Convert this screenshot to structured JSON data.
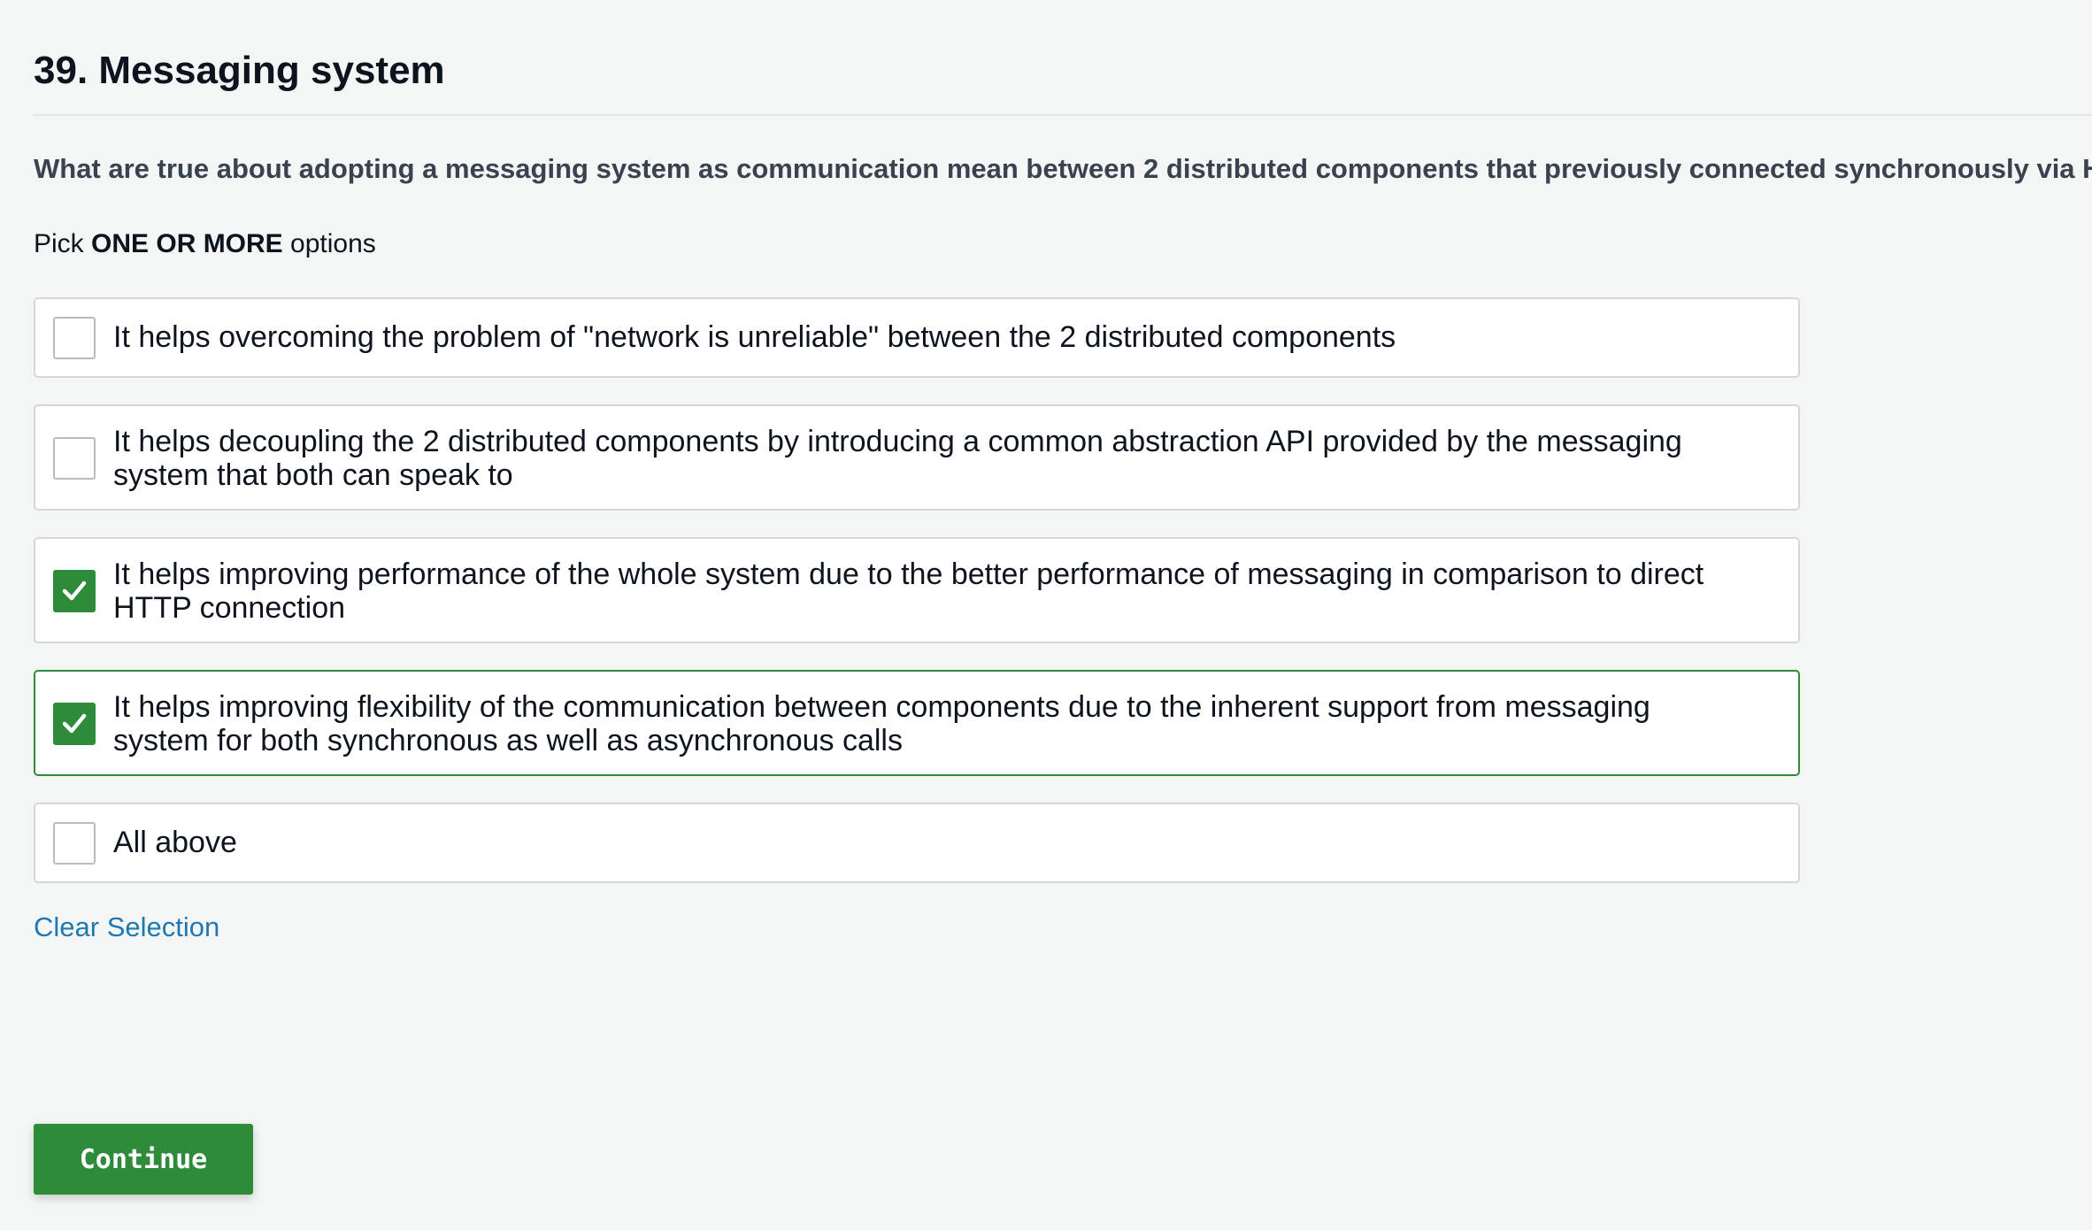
{
  "question": {
    "title": "39. Messaging system",
    "text": "What are true about adopting a messaging system as communication mean between 2 distributed components that previously connected synchronously via HTTP?",
    "instruction_prefix": "Pick ",
    "instruction_emphasis": "ONE OR MORE",
    "instruction_suffix": " options"
  },
  "options": [
    {
      "label": "It helps overcoming the problem of \"network is unreliable\" between the 2 distributed components",
      "checked": false
    },
    {
      "label": "It helps decoupling the 2 distributed components by introducing a common abstraction API provided by the messaging system that both can speak to",
      "checked": false
    },
    {
      "label": "It helps improving performance of the whole system due to the better performance of messaging in comparison to direct HTTP connection",
      "checked": true
    },
    {
      "label": "It helps improving flexibility of the communication between components due to the inherent support from messaging system for both synchronous as well as asynchronous calls",
      "checked": true
    },
    {
      "label": "All above",
      "checked": false
    }
  ],
  "actions": {
    "clear_label": "Clear Selection",
    "continue_label": "Continue"
  },
  "colors": {
    "accent": "#2e8b3a",
    "link": "#1f78b4",
    "background": "#f4f6f6"
  }
}
